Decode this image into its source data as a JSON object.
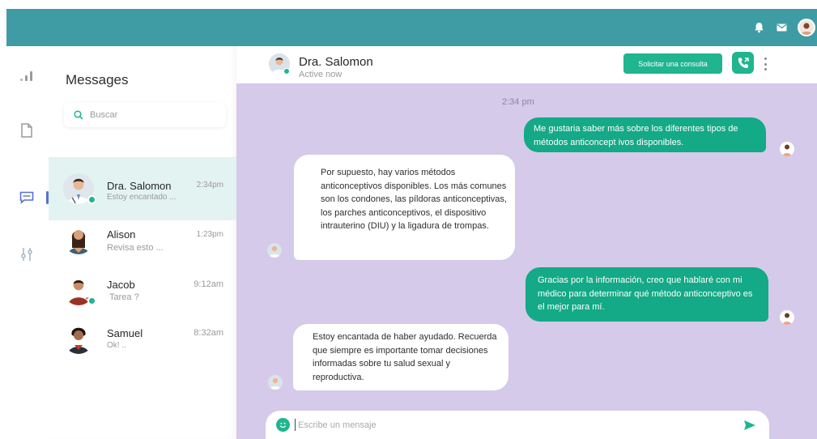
{
  "colors": {
    "topbar": "#3f9ca5",
    "accent_green": "#1fb58f",
    "outgoing_bubble": "#14a987",
    "chat_background": "#d5cae9",
    "active_contact": "#e3f3f1",
    "rail_active": "#5a6fd1"
  },
  "topbar": {
    "icons": [
      "bell-icon",
      "mail-icon",
      "user-avatar"
    ]
  },
  "rail": {
    "icons": [
      "stats-icon",
      "document-icon",
      "chat-icon",
      "sliders-icon"
    ],
    "active": "chat-icon"
  },
  "sidebar": {
    "title": "Messages",
    "search_placeholder": "Buscar",
    "contacts": [
      {
        "name": "Dra. Salomon",
        "preview": "Estoy encantado ...",
        "time": "2:34pm",
        "online": true,
        "active": true
      },
      {
        "name": "Alison",
        "preview": "Revisa esto ...",
        "time": "1:23pm",
        "online": false,
        "active": false
      },
      {
        "name": "Jacob",
        "preview": "Tarea ?",
        "time": "9:12am",
        "online": true,
        "active": false
      },
      {
        "name": "Samuel",
        "preview": "Ok! ..",
        "time": "8:32am",
        "online": false,
        "active": false
      }
    ]
  },
  "chat": {
    "contact_name": "Dra. Salomon",
    "status": "Active now",
    "consult_button": "Solicitar una consulta",
    "timestamp": "2:34 pm",
    "messages": [
      {
        "direction": "out",
        "text": "Me gustaria saber más sobre los diferentes tipos de métodos anticoncept ivos disponibles."
      },
      {
        "direction": "in",
        "text": "Por supuesto, hay varios métodos anticonceptivos disponibles. Los más comunes son los condones, las píldoras anticonceptivas, los parches anticonceptivos, el dispositivo intrauterino (DIU) y la ligadura de trompas."
      },
      {
        "direction": "out",
        "text": "Gracias por la información, creo que hablaré con mi médico para determinar qué método anticonceptivo es el mejor para mí."
      },
      {
        "direction": "in",
        "text": "Estoy encantada de haber ayudado. Recuerda que siempre es importante tomar decisiones informadas sobre tu salud sexual y reproductiva."
      }
    ],
    "composer_placeholder": "Escribe un mensaje"
  }
}
